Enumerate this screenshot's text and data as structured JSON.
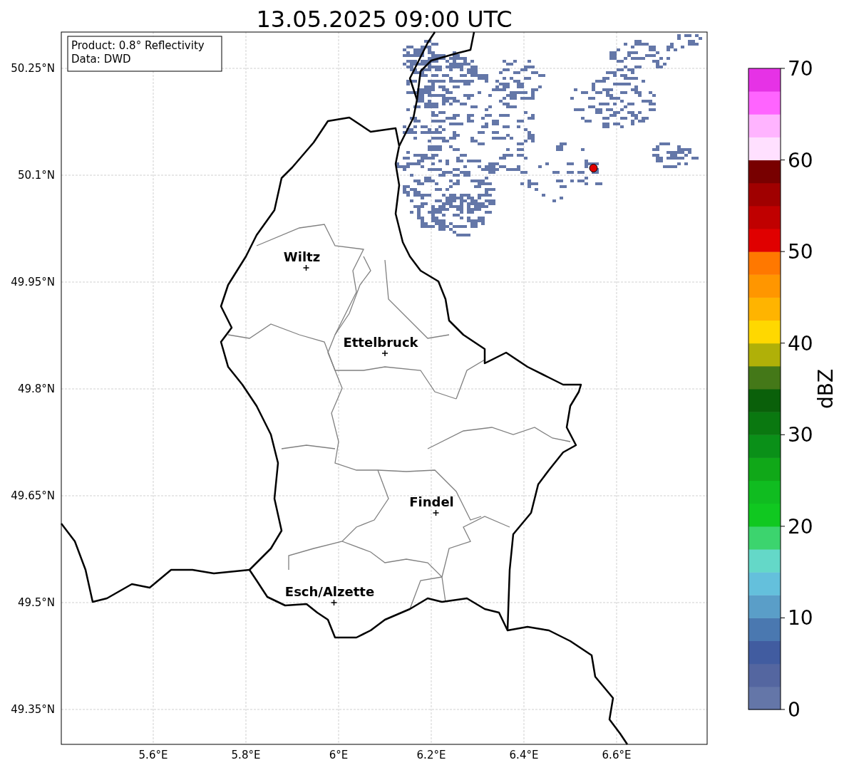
{
  "title": "13.05.2025 09:00 UTC",
  "info_box": [
    "Product: 0.8° Reflectivity",
    "Data: DWD"
  ],
  "map": {
    "lat_ticks": [
      "50.25°N",
      "50.1°N",
      "49.95°N",
      "49.8°N",
      "49.65°N",
      "49.5°N",
      "49.35°N"
    ],
    "lon_ticks": [
      "5.6°E",
      "5.8°E",
      "6°E",
      "6.2°E",
      "6.4°E",
      "6.6°E"
    ],
    "cities": [
      "Wiltz",
      "Ettelbruck",
      "Findel",
      "Esch/Alzette"
    ]
  },
  "colorbar": {
    "label": "dBZ",
    "ticks": [
      "70",
      "60",
      "50",
      "40",
      "30",
      "20",
      "10",
      "0"
    ]
  }
}
